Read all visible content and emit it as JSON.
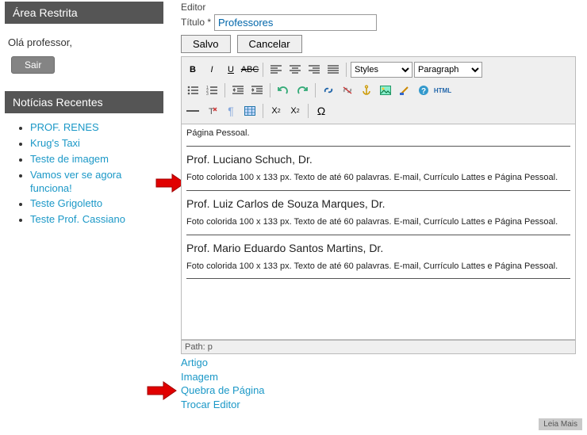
{
  "sidebar": {
    "restricted_title": "Área Restrita",
    "greeting": "Olá professor,",
    "logout_label": "Sair",
    "news_title": "Notícias Recentes",
    "news_items": [
      "PROF. RENES",
      "Krug's Taxi",
      "Teste de imagem",
      "Vamos ver se agora funciona!",
      "Teste Grigoletto",
      "Teste Prof. Cassiano"
    ]
  },
  "editor": {
    "label": "Editor",
    "title_label": "Título *",
    "title_value": "Professores",
    "save_label": "Salvo",
    "cancel_label": "Cancelar",
    "styles_placeholder": "Styles",
    "paragraph_placeholder": "Paragraph",
    "path_label": "Path: p"
  },
  "content": {
    "intro_tail": "Página Pessoal.",
    "profs": [
      {
        "name": "Prof. Luciano Schuch, Dr.",
        "desc": "Foto colorida 100 x 133 px. Texto de até 60 palavras. E-mail, Currículo Lattes e Página Pessoal."
      },
      {
        "name": "Prof. Luiz Carlos de Souza Marques, Dr.",
        "desc": "Foto colorida 100 x 133 px. Texto de até 60 palavras. E-mail, Currículo Lattes e Página Pessoal."
      },
      {
        "name": "Prof. Mario Eduardo Santos Martins, Dr.",
        "desc": "Foto colorida 100 x 133 px. Texto de até 60 palavras. E-mail, Currículo Lattes e Página Pessoal."
      }
    ]
  },
  "actions": {
    "artigo": "Artigo",
    "imagem": "Imagem",
    "quebra": "Quebra de Página",
    "trocar": "Trocar Editor"
  },
  "footer": {
    "read_more": "Leia Mais"
  }
}
